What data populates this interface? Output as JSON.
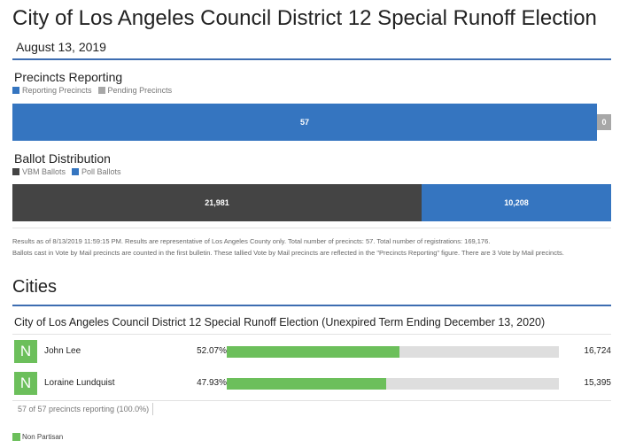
{
  "header": {
    "title": "City of Los Angeles Council District 12 Special Runoff Election",
    "date": "August 13, 2019"
  },
  "precincts": {
    "heading": "Precincts Reporting",
    "legend": [
      {
        "label": "Reporting Precincts",
        "color": "#3575c0"
      },
      {
        "label": "Pending Precincts",
        "color": "#a7a7a7"
      }
    ],
    "reporting": "57",
    "pending": "0"
  },
  "ballots": {
    "heading": "Ballot Distribution",
    "legend": [
      {
        "label": "VBM Ballots",
        "color": "#444444"
      },
      {
        "label": "Poll Ballots",
        "color": "#3575c0"
      }
    ],
    "vbm": "21,981",
    "poll": "10,208"
  },
  "notes": {
    "line1": "Results as of 8/13/2019 11:59:15 PM. Results are representative of Los Angeles County only. Total number of precincts: 57. Total number of registrations: 169,176.",
    "line2": "Ballots cast in Vote by Mail precincts are counted in the first bulletin. These tallied Vote by Mail precincts are reflected in the \"Precincts Reporting\" figure. There are 3 Vote by Mail precincts."
  },
  "cities": {
    "heading": "Cities",
    "contest": "City of Los Angeles Council District 12 Special Runoff Election (Unexpired Term Ending December 13, 2020)",
    "candidates": [
      {
        "party": "N",
        "name": "John Lee",
        "percent": "52.07%",
        "share": 0.5207,
        "votes": "16,724"
      },
      {
        "party": "N",
        "name": "Loraine Lundquist",
        "percent": "47.93%",
        "share": 0.4793,
        "votes": "15,395"
      }
    ],
    "precincts_reporting": "57 of 57 precincts reporting (100.0%)"
  },
  "footer": {
    "legend_label": "Non Partisan",
    "legend_color": "#6cbf5b"
  }
}
